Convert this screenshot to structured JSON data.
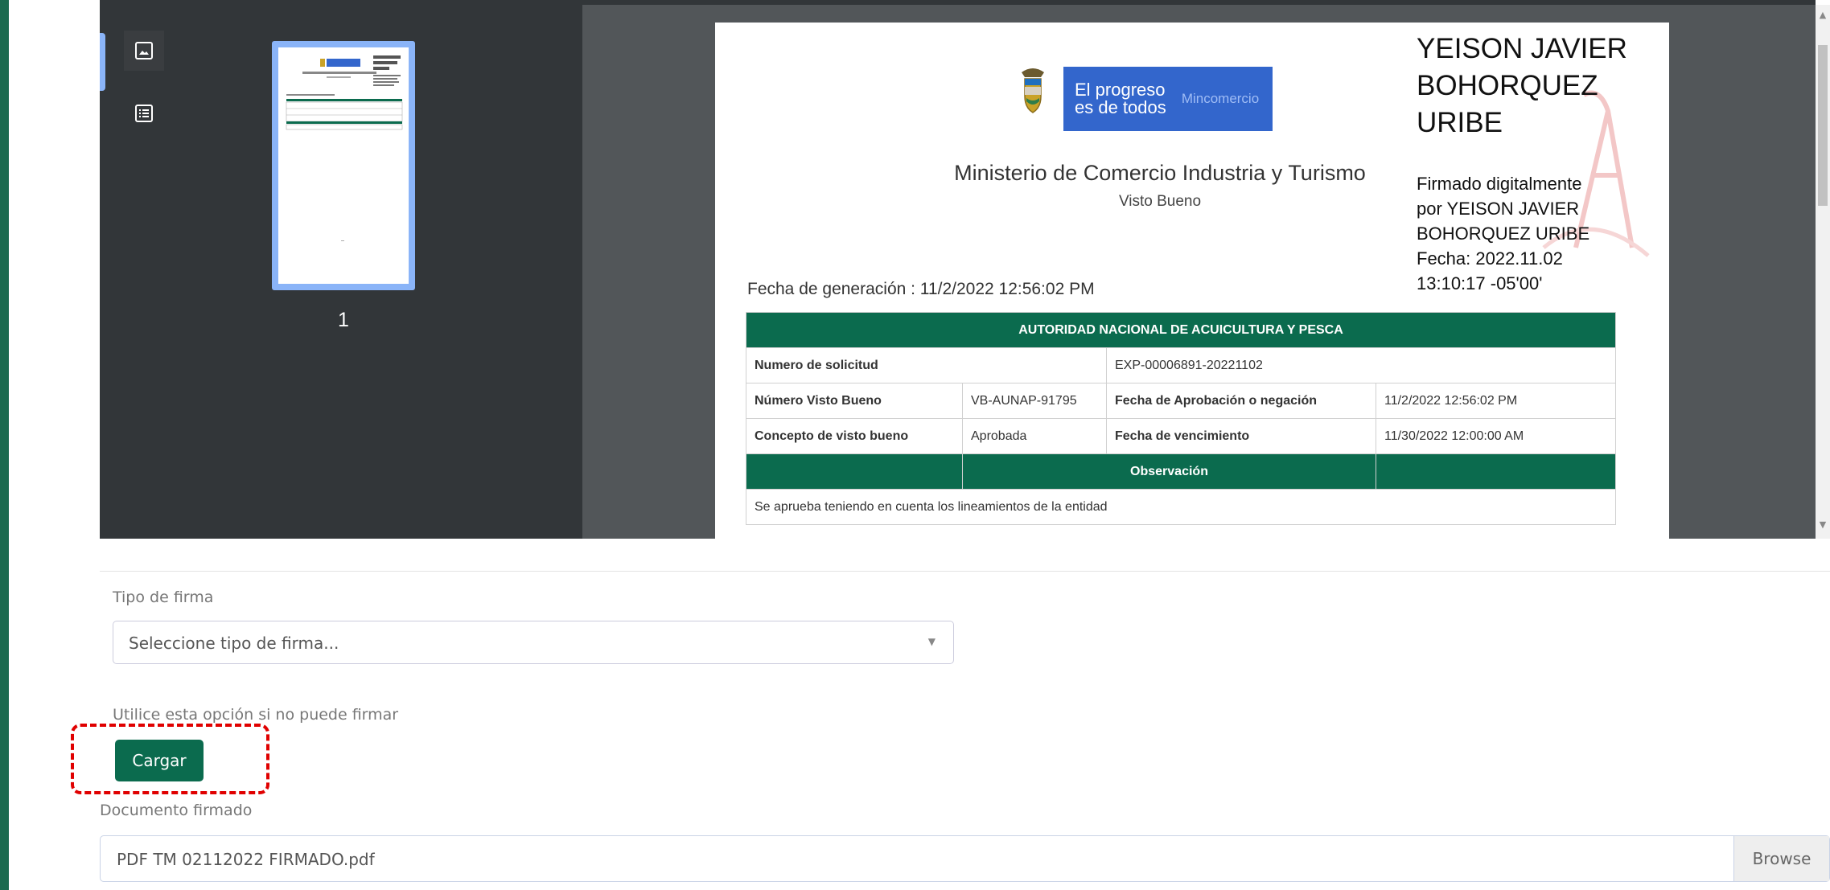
{
  "viewer": {
    "thumbnail_page_number": "1"
  },
  "document": {
    "brand_line1": "El progreso",
    "brand_line2": "es de todos",
    "brand_right": "Mincomercio",
    "ministry": "Ministerio de Comercio Industria y Turismo",
    "subtitle": "Visto Bueno",
    "generation_date": "Fecha de generación : 11/2/2022 12:56:02 PM",
    "signature": {
      "name_lines": [
        "YEISON JAVIER",
        "BOHORQUEZ",
        "URIBE"
      ],
      "detail_lines": [
        "Firmado digitalmente",
        "por YEISON JAVIER",
        "BOHORQUEZ URIBE",
        "Fecha: 2022.11.02",
        "13:10:17 -05'00'"
      ]
    },
    "table": {
      "header": "AUTORIDAD NACIONAL DE ACUICULTURA Y PESCA",
      "rows": [
        {
          "label": "Numero de solicitud",
          "value": "EXP-00006891-20221102"
        },
        {
          "label": "Número Visto Bueno",
          "value": "VB-AUNAP-91795",
          "label2": "Fecha de Aprobación o negación",
          "value2": "11/2/2022 12:56:02 PM"
        },
        {
          "label": "Concepto de visto bueno",
          "value": "Aprobada",
          "label2": "Fecha de vencimiento",
          "value2": "11/30/2022 12:00:00 AM"
        }
      ],
      "observation_header": "Observación",
      "observation_text": "Se aprueba teniendo en cuenta los lineamientos de la entidad"
    }
  },
  "form": {
    "signature_type_label": "Tipo de firma",
    "signature_type_placeholder": "Seleccione tipo de firma...",
    "hint": "Utilice esta opción si no puede firmar",
    "upload_button": "Cargar",
    "signed_doc_label": "Documento firmado",
    "signed_doc_value": "PDF TM 02112022 FIRMADO.pdf",
    "browse_button": "Browse"
  },
  "colors": {
    "accent": "#1b6b4f",
    "table_header": "#0b6b4e",
    "highlight": "#e00000"
  }
}
